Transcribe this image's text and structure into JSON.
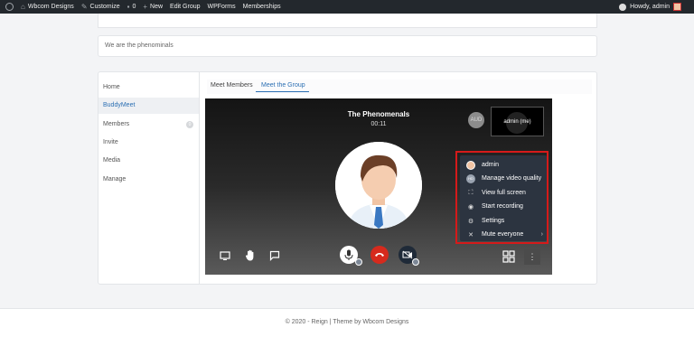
{
  "adminbar": {
    "site_name": "Wbcom Designs",
    "customize": "Customize",
    "comments_count": "0",
    "new": "New",
    "edit_group": "Edit Group",
    "wpforms": "WPForms",
    "memberships": "Memberships",
    "howdy": "Howdy, admin"
  },
  "group": {
    "description": "We are the phenominals"
  },
  "nav": {
    "items": [
      {
        "label": "Home"
      },
      {
        "label": "BuddyMeet",
        "active": true
      },
      {
        "label": "Members",
        "badge": "0"
      },
      {
        "label": "Invite"
      },
      {
        "label": "Media"
      },
      {
        "label": "Manage"
      }
    ]
  },
  "tabs": [
    {
      "label": "Meet Members"
    },
    {
      "label": "Meet the Group",
      "active": true
    }
  ],
  "meeting": {
    "title": "The Phenomenals",
    "timer": "00:11",
    "aud_label": "AUD",
    "self_label": "admin (me)"
  },
  "menu": {
    "items": [
      {
        "label": "admin",
        "icon": "user-avatar-icon"
      },
      {
        "label": "Manage video quality",
        "icon": "hd-icon"
      },
      {
        "label": "View full screen",
        "icon": "fullscreen-icon"
      },
      {
        "label": "Start recording",
        "icon": "record-icon"
      },
      {
        "label": "Settings",
        "icon": "gear-icon"
      },
      {
        "label": "Mute everyone",
        "icon": "mute-everyone-icon"
      }
    ]
  },
  "footer": {
    "text": "© 2020 - Reign | Theme by Wbcom Designs"
  },
  "colors": {
    "accent": "#2b6fb3",
    "hangup": "#d62a1d",
    "highlight": "#d51a1a",
    "adminbar": "#23282d"
  }
}
